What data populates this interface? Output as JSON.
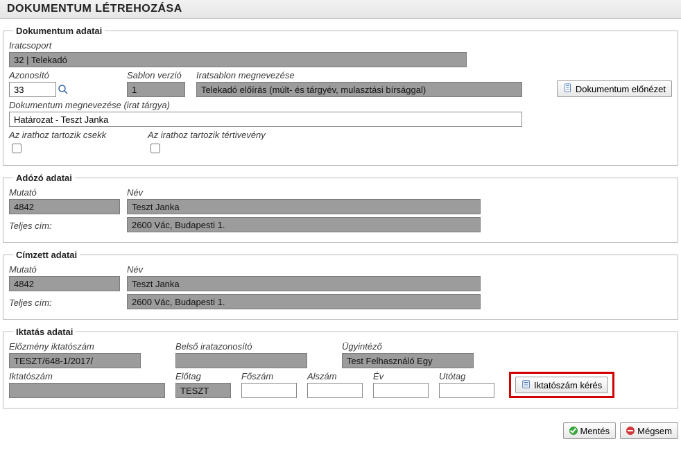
{
  "title": "DOKUMENTUM LÉTREHOZÁSA",
  "doc": {
    "legend": "Dokumentum adatai",
    "iratcsoport_label": "Iratcsoport",
    "iratcsoport_value": "32 | Telekadó",
    "azonosito_label": "Azonosító",
    "azonosito_value": "33",
    "sablon_verzio_label": "Sablon verzió",
    "sablon_verzio_value": "1",
    "iratsablon_label": "Iratsablon megnevezése",
    "iratsablon_value": "Telekadó előírás (múlt- és tárgyév, mulasztási bírsággal)",
    "preview_button": "Dokumentum előnézet",
    "megnevezes_label": "Dokumentum megnevezése (irat tárgya)",
    "megnevezes_value": "Határozat - Teszt Janka",
    "csekk_label": "Az irathoz tartozik csekk",
    "tertiveveny_label": "Az irathoz tartozik tértivevény"
  },
  "adozo": {
    "legend": "Adózó adatai",
    "mutato_label": "Mutató",
    "mutato_value": "4842",
    "nev_label": "Név",
    "nev_value": "Teszt Janka",
    "cim_label": "Teljes cím:",
    "cim_value": "2600 Vác, Budapesti 1."
  },
  "cimzett": {
    "legend": "Címzett adatai",
    "mutato_label": "Mutató",
    "mutato_value": "4842",
    "nev_label": "Név",
    "nev_value": "Teszt Janka",
    "cim_label": "Teljes cím:",
    "cim_value": "2600 Vác, Budapesti 1."
  },
  "iktatas": {
    "legend": "Iktatás adatai",
    "elozmeny_label": "Előzmény iktatószám",
    "elozmeny_value": "TESZT/648-1/2017/",
    "belso_label": "Belső iratazonosító",
    "belso_value": "",
    "ugyintezo_label": "Ügyintéző",
    "ugyintezo_value": "Test Felhasználó Egy",
    "iktatoszam_label": "Iktatószám",
    "iktatoszam_value": "",
    "elotag_label": "Előtag",
    "elotag_value": "TESZT",
    "foszam_label": "Főszám",
    "foszam_value": "",
    "alszam_label": "Alszám",
    "alszam_value": "",
    "ev_label": "Év",
    "ev_value": "",
    "utotag_label": "Utótag",
    "utotag_value": "",
    "keres_button": "Iktatószám kérés"
  },
  "footer": {
    "mentes": "Mentés",
    "megsem": "Mégsem"
  }
}
